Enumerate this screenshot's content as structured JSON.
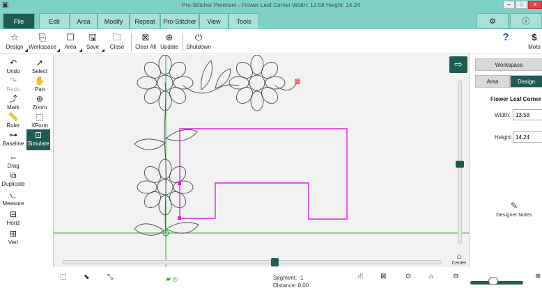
{
  "window": {
    "title": "Pro-Stitcher Premium  -  Flower Leaf Corner  Width: 13.58  Height: 14.24"
  },
  "tabs": [
    {
      "label": "File",
      "active": true
    },
    {
      "label": "Edit"
    },
    {
      "label": "Area"
    },
    {
      "label": "Modify"
    },
    {
      "label": "Repeat"
    },
    {
      "label": "Pro-Stitcher"
    },
    {
      "label": "View"
    },
    {
      "label": "Tools"
    }
  ],
  "toolbar": {
    "design": "Design",
    "workspace": "Workspace",
    "area": "Area",
    "save": "Save",
    "close": "Close",
    "clear_all": "Clear All",
    "update": "Update",
    "shutdown": "Shutdown",
    "motor": "Moto"
  },
  "left_tools": {
    "undo": "Undo",
    "select": "Select",
    "redo": "Redo",
    "pan": "Pan",
    "mark": "Mark",
    "zoom": "Zoom",
    "ruler": "Ruler",
    "xform": "XForm",
    "baseline": "Baseline",
    "simulate": "Simulate",
    "drag": "Drag",
    "duplicate": "Duplicate",
    "measure": "Measure",
    "horiz": "Horiz",
    "vert": "Vert"
  },
  "canvas": {
    "center_label": "Center",
    "vslider_value": 0.51,
    "hslider_value": 0.56
  },
  "right_panel": {
    "workspace_tab": "Workspace",
    "area_tab": "Area",
    "design_tab": "Design",
    "design_name": "Flower Leaf Corner",
    "width_label": "Width:",
    "width_value": "13.58",
    "height_label": "Height:",
    "height_value": "14.24",
    "designer_notes": "Designer Notes"
  },
  "status": {
    "segment": "Segment: -1",
    "distance": "Distance: 0.00"
  },
  "colors": {
    "accent": "#1f5b52",
    "title_bg": "#7fd1c7",
    "area_outline": "#e020e0",
    "design_line": "#555555",
    "guide_line": "#1fb51f",
    "end_marker": "#e03030"
  }
}
